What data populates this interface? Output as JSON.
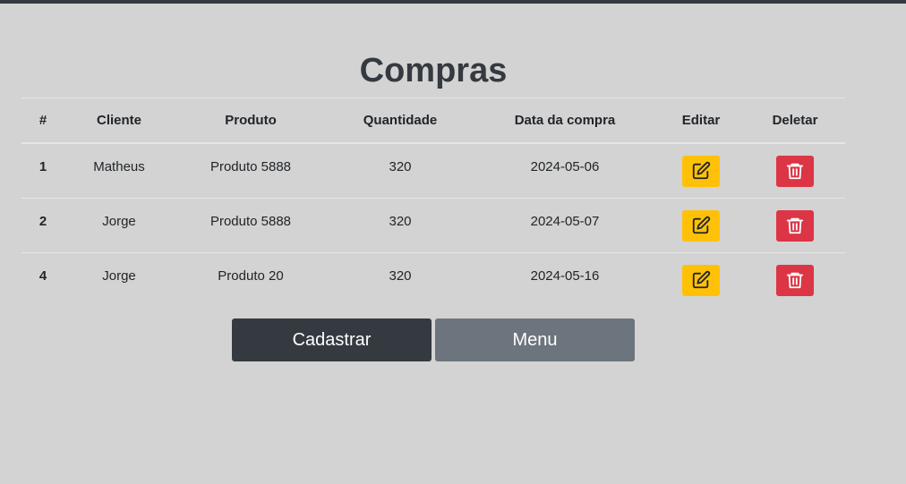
{
  "page": {
    "title": "Compras"
  },
  "table": {
    "headers": {
      "id": "#",
      "cliente": "Cliente",
      "produto": "Produto",
      "quantidade": "Quantidade",
      "data": "Data da compra",
      "editar": "Editar",
      "deletar": "Deletar"
    },
    "rows": [
      {
        "id": "1",
        "cliente": "Matheus",
        "produto": "Produto 5888",
        "quantidade": "320",
        "data": "2024-05-06"
      },
      {
        "id": "2",
        "cliente": "Jorge",
        "produto": "Produto 5888",
        "quantidade": "320",
        "data": "2024-05-07"
      },
      {
        "id": "4",
        "cliente": "Jorge",
        "produto": "Produto 20",
        "quantidade": "320",
        "data": "2024-05-16"
      }
    ]
  },
  "icons": {
    "edit": "pencil-square-icon",
    "delete": "trash-icon"
  },
  "buttons": {
    "cadastrar": "Cadastrar",
    "menu": "Menu"
  },
  "colors": {
    "background": "#d3d3d3",
    "dark": "#343a40",
    "secondary": "#6c757d",
    "warning": "#ffc107",
    "danger": "#dc3545"
  }
}
